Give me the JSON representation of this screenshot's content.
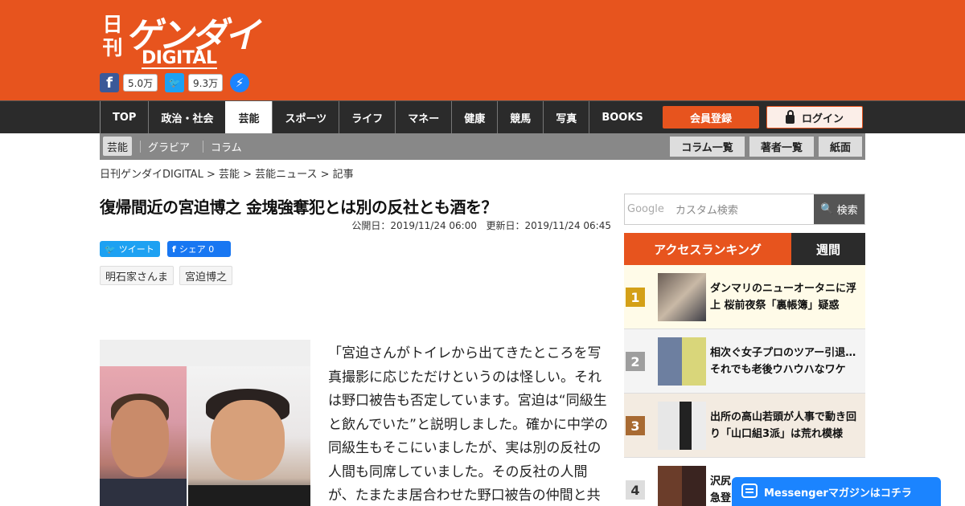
{
  "header": {
    "logo_kanji": "日刊",
    "logo_main": "ゲンダイ",
    "logo_sub": "DIGITAL",
    "facebook_count": "5.0万",
    "twitter_count": "9.3万"
  },
  "nav": {
    "items": [
      "TOP",
      "政治・社会",
      "芸能",
      "スポーツ",
      "ライフ",
      "マネー",
      "健康",
      "競馬",
      "写真",
      "BOOKS"
    ],
    "active": "芸能",
    "register": "会員登録",
    "login": "ログイン"
  },
  "subnav": {
    "items": [
      "芸能",
      "グラビア",
      "コラム"
    ],
    "buttons": [
      "コラム一覧",
      "著者一覧",
      "紙面"
    ]
  },
  "breadcrumb": "日刊ゲンダイDIGITAL > 芸能 > 芸能ニュース > 記事",
  "article": {
    "title": "復帰間近の宮迫博之 金塊強奪犯とは別の反社とも酒を？",
    "published": "公開日：2019/11/24 06:00",
    "updated": "更新日：2019/11/24 06:45",
    "tweet": "ツイート",
    "share": "シェア 0",
    "tags": [
      "明石家さんま",
      "宮迫博之"
    ],
    "body": "「宮迫さんがトイレから出てきたところを写真撮影に応じただけというのは怪しい。それは野口被告も否定しています。宮迫は“同級生と飲んでいた”と説明しました。確かに中学の同級生もそこにいましたが、実は別の反社の人間も同席していました。その反社の人間が、たまたま居合わせた野口被告の仲間と共"
  },
  "search": {
    "google_label": "Google",
    "placeholder": "カスタム検索",
    "button": "検索"
  },
  "ranking": {
    "title": "アクセスランキング",
    "tab": "週間",
    "items": [
      {
        "rank": "1",
        "text": "ダンマリのニューオータニに浮上 桜前夜祭「裏帳簿」疑惑"
      },
      {
        "rank": "2",
        "text": "相次ぐ女子プロのツアー引退…それでも老後ウハウハなワケ"
      },
      {
        "rank": "3",
        "text": "出所の高山若頭が人事で動き回り「山口組3派」は荒れ模様"
      },
      {
        "rank": "4",
        "text": "沢尻\n急登"
      }
    ],
    "colors": [
      "#d4a017",
      "#9e9e9e",
      "#a86a32",
      "#dddddd"
    ]
  },
  "messenger_banner": "Messengerマガジンはコチラ"
}
